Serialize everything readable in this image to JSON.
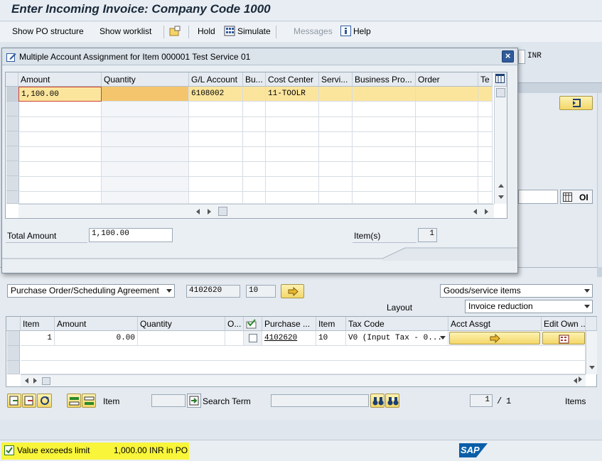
{
  "window": {
    "title": "Enter Incoming Invoice: Company Code 1000"
  },
  "toolbar": {
    "show_po_structure": "Show PO structure",
    "show_worklist": "Show worklist",
    "hold": "Hold",
    "simulate": "Simulate",
    "messages": "Messages",
    "help": "Help"
  },
  "background": {
    "currency": "INR",
    "oi_label": "OI"
  },
  "popup": {
    "title": "Multiple Account Assignment for Item 000001 Test Service 01",
    "columns": [
      "Amount",
      "Quantity",
      "G/L Account",
      "Bu...",
      "Cost Center",
      "Servi...",
      "Business Pro...",
      "Order",
      "Te"
    ],
    "row1": {
      "amount": "1,100.00",
      "quantity": "",
      "gl_account": "6108002",
      "bu": "",
      "cost_center": "11-TOOLR",
      "service": "",
      "business_process": "",
      "order": ""
    },
    "total_amount_label": "Total Amount",
    "total_amount_value": "1,100.00",
    "items_label": "Item(s)",
    "items_value": "1"
  },
  "po_section": {
    "reference_type": "Purchase Order/Scheduling Agreement",
    "po_number": "4102620",
    "po_item": "10",
    "goods_service": "Goods/service items",
    "layout_label": "Layout",
    "layout_value": "Invoice reduction"
  },
  "items_table": {
    "columns": [
      "Item",
      "Amount",
      "Quantity",
      "O...",
      "",
      "Purchase ...",
      "Item",
      "Tax Code",
      "Acct Assgt",
      "Edit Own ..."
    ],
    "row1": {
      "item": "1",
      "amount": "0.00",
      "quantity": "",
      "purchase_order": "4102620",
      "po_item": "10",
      "tax_code": "V0 (Input Tax - 0..."
    }
  },
  "bottom_toolbar": {
    "item_label": "Item",
    "item_value": "",
    "search_term_label": "Search Term",
    "search_term_value": "",
    "page_current": "1",
    "page_sep": "/",
    "page_total": "1",
    "items_label": "Items"
  },
  "statusbar": {
    "message": "Value exceeds limit",
    "detail": "1,000.00 INR in PO",
    "brand": "SAP"
  },
  "colors": {
    "sap_blue": "#2f5b9b",
    "highlight_row": "#fbe59d",
    "status_highlight": "#f8f53a"
  }
}
